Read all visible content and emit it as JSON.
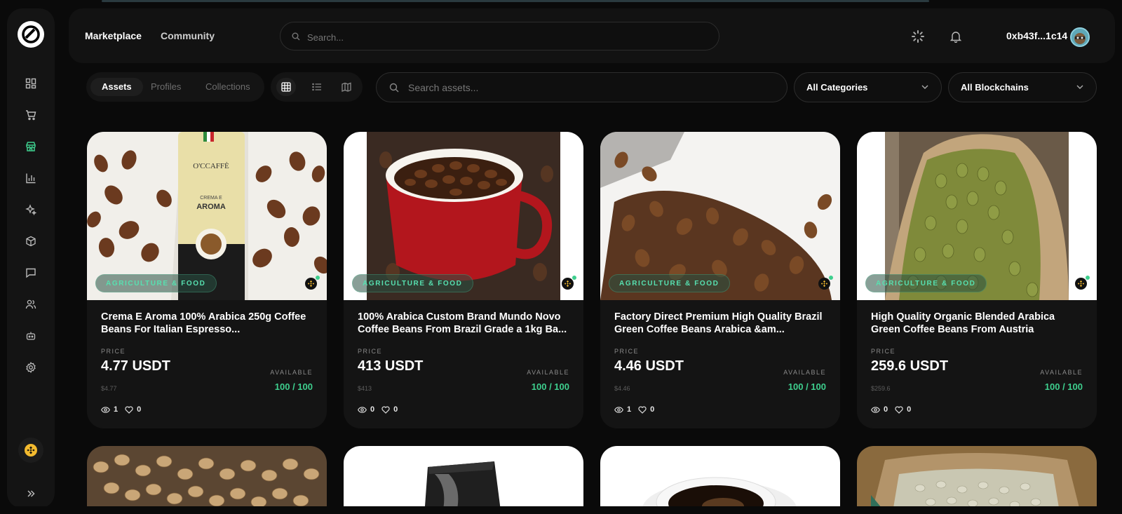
{
  "topbar": {
    "nav": [
      {
        "label": "Marketplace"
      },
      {
        "label": "Community"
      }
    ],
    "search_placeholder": "Search...",
    "wallet_address": "0xb43f...1c14"
  },
  "sidebar": {
    "items": [
      {
        "icon": "dashboard-icon"
      },
      {
        "icon": "cart-icon"
      },
      {
        "icon": "store-icon",
        "active": true
      },
      {
        "icon": "bar-chart-icon"
      },
      {
        "icon": "sparkles-icon"
      },
      {
        "icon": "cube-icon"
      },
      {
        "icon": "chat-icon"
      },
      {
        "icon": "users-icon"
      },
      {
        "icon": "bot-icon"
      },
      {
        "icon": "settings-icon"
      }
    ]
  },
  "filters": {
    "tabs": [
      {
        "label": "Assets",
        "active": true
      },
      {
        "label": "Profiles"
      },
      {
        "label": "Collections"
      }
    ],
    "view_modes": [
      "grid-icon",
      "list-icon",
      "map-icon"
    ],
    "asset_search_placeholder": "Search assets...",
    "category_dropdown": "All Categories",
    "blockchain_dropdown": "All Blockchains"
  },
  "colors": {
    "accent": "#3ecf8e",
    "background": "#0a0a0a",
    "card": "#141414"
  },
  "listings": [
    {
      "category": "AGRICULTURE & FOOD",
      "title": "Crema E Aroma 100% Arabica 250g Coffee Beans For Italian Espresso...",
      "price_label": "PRICE",
      "price": "4.77 USDT",
      "price_usd": "$4.77",
      "available_label": "AVAILABLE",
      "available": "100 / 100",
      "views": "1",
      "likes": "0",
      "package_brand": "O'CCAFFÈ",
      "package_line1": "CREMA E",
      "package_line2": "AROMA"
    },
    {
      "category": "AGRICULTURE & FOOD",
      "title": "100% Arabica Custom Brand Mundo Novo Coffee Beans From Brazil Grade a 1kg Ba...",
      "price_label": "PRICE",
      "price": "413 USDT",
      "price_usd": "$413",
      "available_label": "AVAILABLE",
      "available": "100 / 100",
      "views": "0",
      "likes": "0"
    },
    {
      "category": "AGRICULTURE & FOOD",
      "title": "Factory Direct Premium High Quality Brazil Green Coffee Beans Arabica &am...",
      "price_label": "PRICE",
      "price": "4.46 USDT",
      "price_usd": "$4.46",
      "available_label": "AVAILABLE",
      "available": "100 / 100",
      "views": "1",
      "likes": "0"
    },
    {
      "category": "AGRICULTURE & FOOD",
      "title": "High Quality Organic Blended Arabica Green Coffee Beans From Austria",
      "price_label": "PRICE",
      "price": "259.6 USDT",
      "price_usd": "$259.6",
      "available_label": "AVAILABLE",
      "available": "100 / 100",
      "views": "0",
      "likes": "0"
    }
  ]
}
